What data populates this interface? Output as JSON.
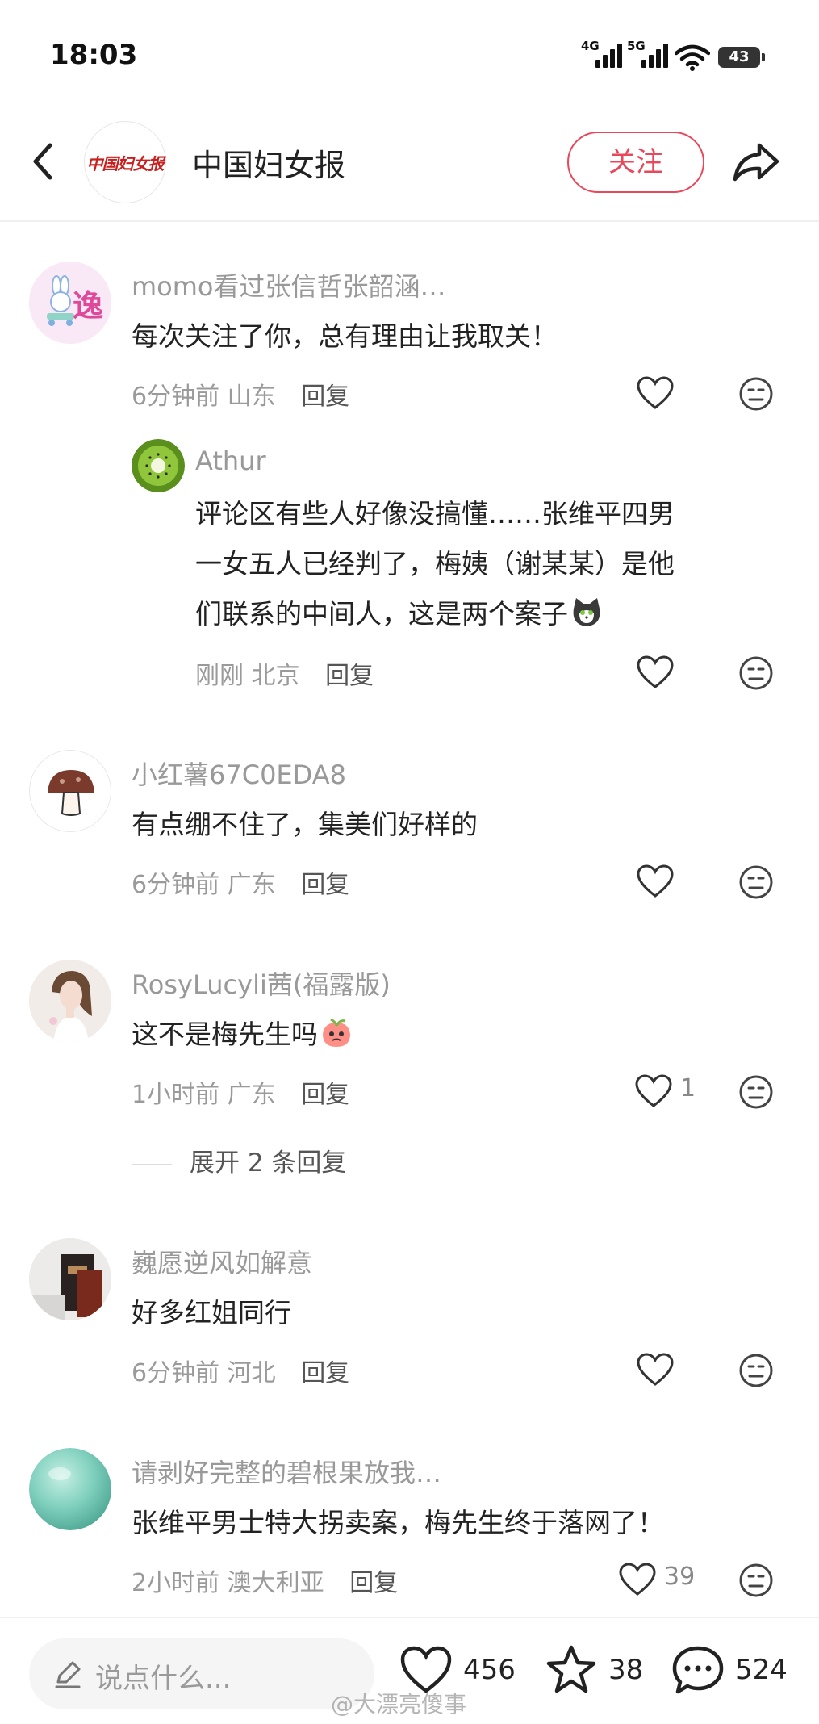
{
  "status_bar": {
    "time": "18:03",
    "network1": "4G",
    "network2": "5G",
    "battery": "43",
    "icons": [
      "signal-4g-icon",
      "signal-5g-icon",
      "wifi-icon",
      "battery-icon"
    ]
  },
  "header": {
    "back_icon": "back-arrow-icon",
    "logo_text": "中国妇女报",
    "title": "中国妇女报",
    "follow_label": "关注",
    "share_icon": "share-icon",
    "accent_color": "#e8485c"
  },
  "comments": [
    {
      "username": "momo看过张信哲张韶涵…",
      "text": "每次关注了你，总有理由让我取关！",
      "time": "6分钟前",
      "location": "山东",
      "reply_label": "回复",
      "avatar_char": "逸",
      "replies": [
        {
          "username": "Athur",
          "text_lines": [
            "评论区有些人好像没搞懂……张维平四男",
            "一女五人已经判了，梅姨（谢某某）是他",
            "们联系的中间人，这是两个案子"
          ],
          "time": "刚刚",
          "location": "北京",
          "reply_label": "回复"
        }
      ]
    },
    {
      "username": "小红薯67C0EDA8",
      "text": "有点绷不住了，集美们好样的",
      "time": "6分钟前",
      "location": "广东",
      "reply_label": "回复"
    },
    {
      "username": "RosyLucyli茜(福露版)",
      "text": "这不是梅先生吗",
      "time": "1小时前",
      "location": "广东",
      "reply_label": "回复",
      "likes": "1",
      "expand_label": "展开 2 条回复"
    },
    {
      "username": "巍愿逆风如解意",
      "text": "好多红姐同行",
      "time": "6分钟前",
      "location": "河北",
      "reply_label": "回复"
    },
    {
      "username": "请剥好完整的碧根果放我…",
      "text": "张维平男士特大拐卖案，梅先生终于落网了！",
      "time": "2小时前",
      "location": "澳大利亚",
      "reply_label": "回复",
      "likes": "39"
    }
  ],
  "bottom_bar": {
    "input_placeholder": "说点什么...",
    "likes": "456",
    "favorites": "38",
    "comments": "524"
  },
  "watermark": "@大漂亮傻事"
}
